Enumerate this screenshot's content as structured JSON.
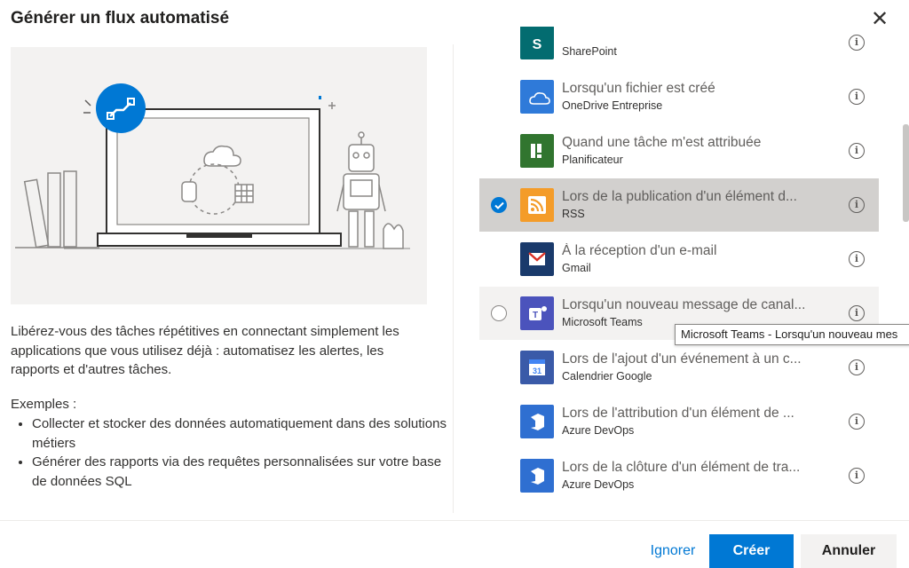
{
  "dialog": {
    "title": "Générer un flux automatisé",
    "close_icon": "close-icon"
  },
  "description": "Libérez-vous des tâches répétitives en connectant simplement les applications que vous utilisez déjà : automatisez les alertes, les rapports et d'autres tâches.",
  "examples": {
    "title": "Exemples :",
    "items": [
      "Collecter et stocker des données automatiquement dans des solutions métiers",
      "Générer des rapports via des requêtes personnalisées sur votre base de données SQL"
    ]
  },
  "triggers": [
    {
      "title": "",
      "subtitle": "SharePoint",
      "icon": "sharepoint-icon",
      "color": "#036c70",
      "state": "normal"
    },
    {
      "title": "Lorsqu'un fichier est créé",
      "subtitle": "OneDrive Entreprise",
      "icon": "onedrive-icon",
      "color": "#2f7ad9",
      "state": "normal"
    },
    {
      "title": "Quand une tâche m'est attribuée",
      "subtitle": "Planificateur",
      "icon": "planner-icon",
      "color": "#31752f",
      "state": "normal"
    },
    {
      "title": "Lors de la publication d'un élément d...",
      "subtitle": "RSS",
      "icon": "rss-icon",
      "color": "#f49c29",
      "state": "selected"
    },
    {
      "title": "À la réception d'un e-mail",
      "subtitle": "Gmail",
      "icon": "gmail-icon",
      "color": "#1a3a6b",
      "state": "normal"
    },
    {
      "title": "Lorsqu'un nouveau message de canal...",
      "subtitle": "Microsoft Teams",
      "icon": "teams-icon",
      "color": "#4b53bc",
      "state": "hovered"
    },
    {
      "title": "Lors de l'ajout d'un événement à un c...",
      "subtitle": "Calendrier Google",
      "icon": "google-calendar-icon",
      "color": "#3a5aa8",
      "state": "normal"
    },
    {
      "title": "Lors de l'attribution d'un élément de ...",
      "subtitle": "Azure DevOps",
      "icon": "azure-devops-icon",
      "color": "#2f6fd1",
      "state": "normal"
    },
    {
      "title": "Lors de la clôture d'un élément de tra...",
      "subtitle": "Azure DevOps",
      "icon": "azure-devops-icon",
      "color": "#2f6fd1",
      "state": "normal"
    }
  ],
  "tooltip": "Microsoft Teams - Lorsqu'un nouveau mes",
  "footer": {
    "ignore_label": "Ignorer",
    "create_label": "Créer",
    "cancel_label": "Annuler"
  },
  "colors": {
    "accent": "#0078d4",
    "selected_row": "#d2d0ce",
    "hover_row": "#f3f2f1"
  }
}
